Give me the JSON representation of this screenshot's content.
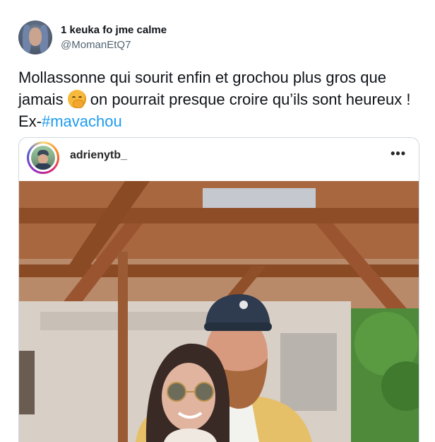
{
  "tweet": {
    "display_name": "1 keuka fo jme calme",
    "handle": "@MomanEtQ7",
    "text_part1": "Mollassonne qui sourit enfin et grochou plus gros que jamais ",
    "emoji": "face-with-hand-over-mouth-emoji",
    "text_part2": " on pourrait presque croire qu’ils sont heureux ! Ex-",
    "hashtag": "#mavachou"
  },
  "embed": {
    "username": "adrienytb_",
    "more_label": "•••"
  },
  "colors": {
    "hashtag": "#1d9bf0",
    "handle": "#536471",
    "card_border": "#cfd9de"
  }
}
